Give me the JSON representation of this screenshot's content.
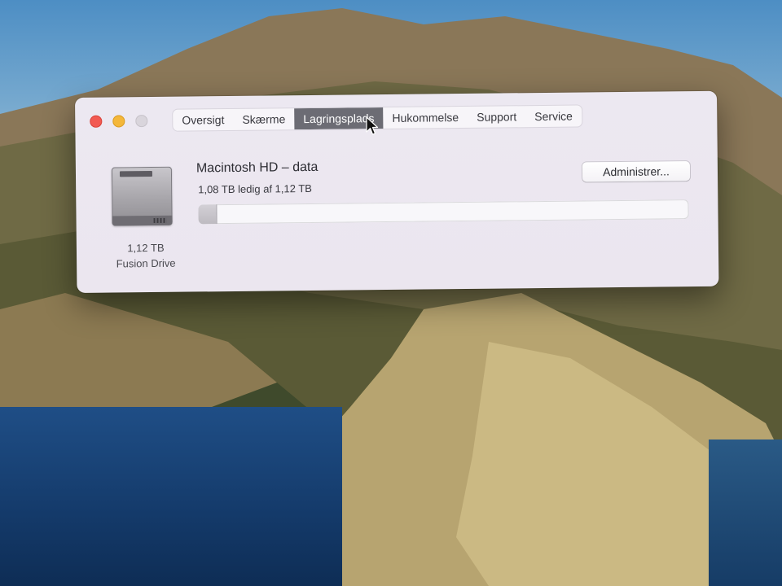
{
  "window": {
    "tabs": [
      {
        "label": "Oversigt",
        "active": false
      },
      {
        "label": "Skærme",
        "active": false
      },
      {
        "label": "Lagringsplads",
        "active": true
      },
      {
        "label": "Hukommelse",
        "active": false
      },
      {
        "label": "Support",
        "active": false
      },
      {
        "label": "Service",
        "active": false
      }
    ]
  },
  "drive": {
    "icon": "hard-drive-icon",
    "size": "1,12 TB",
    "type": "Fusion Drive"
  },
  "volume": {
    "name": "Macintosh HD – data",
    "free_text": "1,08 TB ledig af 1,12 TB",
    "used_fraction": 0.036,
    "manage_label": "Administrer..."
  },
  "colors": {
    "close": "#f25a52",
    "minimize": "#f4b73a",
    "zoom": "#d9d5dc",
    "active_tab": "#6c6c74"
  }
}
